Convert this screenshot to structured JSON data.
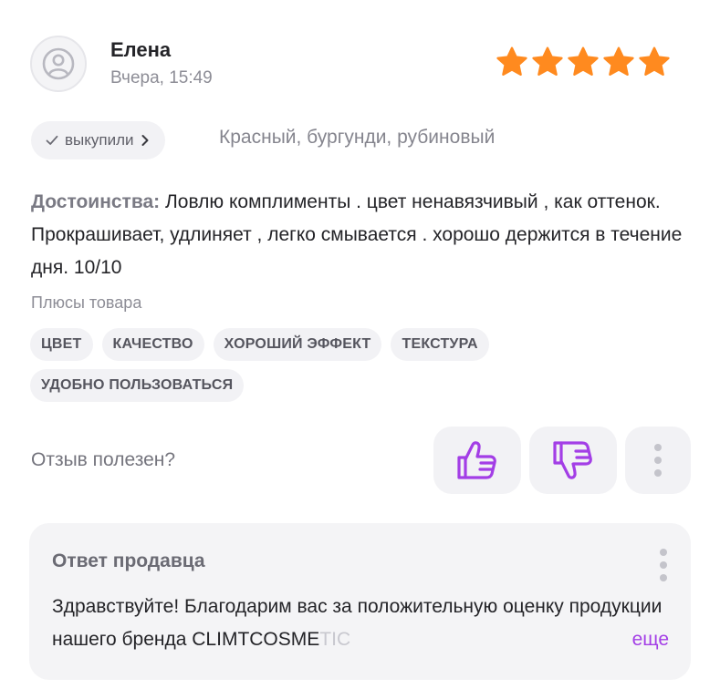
{
  "review": {
    "author": "Елена",
    "date": "Вчера, 15:49",
    "rating": 5,
    "star_color": "#ff8a1f",
    "purchase_badge": "выкупили",
    "variant": "Красный, бургунди, рубиновый",
    "advantages_label": "Достоинства:",
    "advantages_text": "Ловлю комплименты . цвет ненавязчивый , как оттенок. Прокрашивает, удлиняет , легко смывается . хорошо держится в течение дня. 10/10",
    "pros_title": "Плюсы товара",
    "pros_tags": [
      "ЦВЕТ",
      "КАЧЕСТВО",
      "ХОРОШИЙ ЭФФЕКТ",
      "ТЕКСТУРА",
      "УДОБНО ПОЛЬЗОВАТЬСЯ"
    ]
  },
  "helpful": {
    "question": "Отзыв полезен?",
    "like_icon": "thumbs-up-icon",
    "dislike_icon": "thumbs-down-icon",
    "more_icon": "more-vertical-icon",
    "accent_color": "#a33ee6"
  },
  "seller_reply": {
    "title": "Ответ продавца",
    "text_visible": "Здравствуйте! Благодарим вас за положительную оценку продукции нашего бренда CLIMTCOSME",
    "text_faded": "TIC",
    "more_label": "еще"
  }
}
